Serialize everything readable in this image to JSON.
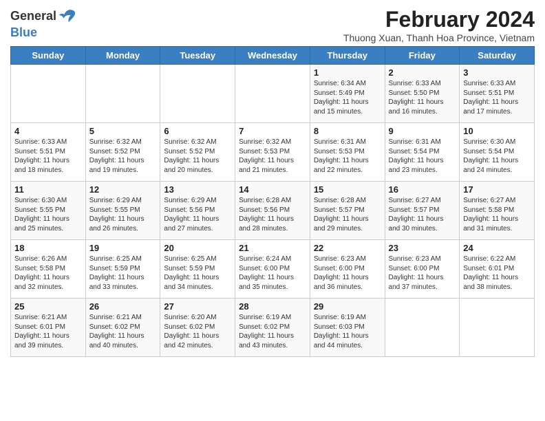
{
  "header": {
    "logo_general": "General",
    "logo_blue": "Blue",
    "month_year": "February 2024",
    "location": "Thuong Xuan, Thanh Hoa Province, Vietnam"
  },
  "days_of_week": [
    "Sunday",
    "Monday",
    "Tuesday",
    "Wednesday",
    "Thursday",
    "Friday",
    "Saturday"
  ],
  "weeks": [
    [
      {
        "day": "",
        "info": ""
      },
      {
        "day": "",
        "info": ""
      },
      {
        "day": "",
        "info": ""
      },
      {
        "day": "",
        "info": ""
      },
      {
        "day": "1",
        "info": "Sunrise: 6:34 AM\nSunset: 5:49 PM\nDaylight: 11 hours and 15 minutes."
      },
      {
        "day": "2",
        "info": "Sunrise: 6:33 AM\nSunset: 5:50 PM\nDaylight: 11 hours and 16 minutes."
      },
      {
        "day": "3",
        "info": "Sunrise: 6:33 AM\nSunset: 5:51 PM\nDaylight: 11 hours and 17 minutes."
      }
    ],
    [
      {
        "day": "4",
        "info": "Sunrise: 6:33 AM\nSunset: 5:51 PM\nDaylight: 11 hours and 18 minutes."
      },
      {
        "day": "5",
        "info": "Sunrise: 6:32 AM\nSunset: 5:52 PM\nDaylight: 11 hours and 19 minutes."
      },
      {
        "day": "6",
        "info": "Sunrise: 6:32 AM\nSunset: 5:52 PM\nDaylight: 11 hours and 20 minutes."
      },
      {
        "day": "7",
        "info": "Sunrise: 6:32 AM\nSunset: 5:53 PM\nDaylight: 11 hours and 21 minutes."
      },
      {
        "day": "8",
        "info": "Sunrise: 6:31 AM\nSunset: 5:53 PM\nDaylight: 11 hours and 22 minutes."
      },
      {
        "day": "9",
        "info": "Sunrise: 6:31 AM\nSunset: 5:54 PM\nDaylight: 11 hours and 23 minutes."
      },
      {
        "day": "10",
        "info": "Sunrise: 6:30 AM\nSunset: 5:54 PM\nDaylight: 11 hours and 24 minutes."
      }
    ],
    [
      {
        "day": "11",
        "info": "Sunrise: 6:30 AM\nSunset: 5:55 PM\nDaylight: 11 hours and 25 minutes."
      },
      {
        "day": "12",
        "info": "Sunrise: 6:29 AM\nSunset: 5:55 PM\nDaylight: 11 hours and 26 minutes."
      },
      {
        "day": "13",
        "info": "Sunrise: 6:29 AM\nSunset: 5:56 PM\nDaylight: 11 hours and 27 minutes."
      },
      {
        "day": "14",
        "info": "Sunrise: 6:28 AM\nSunset: 5:56 PM\nDaylight: 11 hours and 28 minutes."
      },
      {
        "day": "15",
        "info": "Sunrise: 6:28 AM\nSunset: 5:57 PM\nDaylight: 11 hours and 29 minutes."
      },
      {
        "day": "16",
        "info": "Sunrise: 6:27 AM\nSunset: 5:57 PM\nDaylight: 11 hours and 30 minutes."
      },
      {
        "day": "17",
        "info": "Sunrise: 6:27 AM\nSunset: 5:58 PM\nDaylight: 11 hours and 31 minutes."
      }
    ],
    [
      {
        "day": "18",
        "info": "Sunrise: 6:26 AM\nSunset: 5:58 PM\nDaylight: 11 hours and 32 minutes."
      },
      {
        "day": "19",
        "info": "Sunrise: 6:25 AM\nSunset: 5:59 PM\nDaylight: 11 hours and 33 minutes."
      },
      {
        "day": "20",
        "info": "Sunrise: 6:25 AM\nSunset: 5:59 PM\nDaylight: 11 hours and 34 minutes."
      },
      {
        "day": "21",
        "info": "Sunrise: 6:24 AM\nSunset: 6:00 PM\nDaylight: 11 hours and 35 minutes."
      },
      {
        "day": "22",
        "info": "Sunrise: 6:23 AM\nSunset: 6:00 PM\nDaylight: 11 hours and 36 minutes."
      },
      {
        "day": "23",
        "info": "Sunrise: 6:23 AM\nSunset: 6:00 PM\nDaylight: 11 hours and 37 minutes."
      },
      {
        "day": "24",
        "info": "Sunrise: 6:22 AM\nSunset: 6:01 PM\nDaylight: 11 hours and 38 minutes."
      }
    ],
    [
      {
        "day": "25",
        "info": "Sunrise: 6:21 AM\nSunset: 6:01 PM\nDaylight: 11 hours and 39 minutes."
      },
      {
        "day": "26",
        "info": "Sunrise: 6:21 AM\nSunset: 6:02 PM\nDaylight: 11 hours and 40 minutes."
      },
      {
        "day": "27",
        "info": "Sunrise: 6:20 AM\nSunset: 6:02 PM\nDaylight: 11 hours and 42 minutes."
      },
      {
        "day": "28",
        "info": "Sunrise: 6:19 AM\nSunset: 6:02 PM\nDaylight: 11 hours and 43 minutes."
      },
      {
        "day": "29",
        "info": "Sunrise: 6:19 AM\nSunset: 6:03 PM\nDaylight: 11 hours and 44 minutes."
      },
      {
        "day": "",
        "info": ""
      },
      {
        "day": "",
        "info": ""
      }
    ]
  ]
}
